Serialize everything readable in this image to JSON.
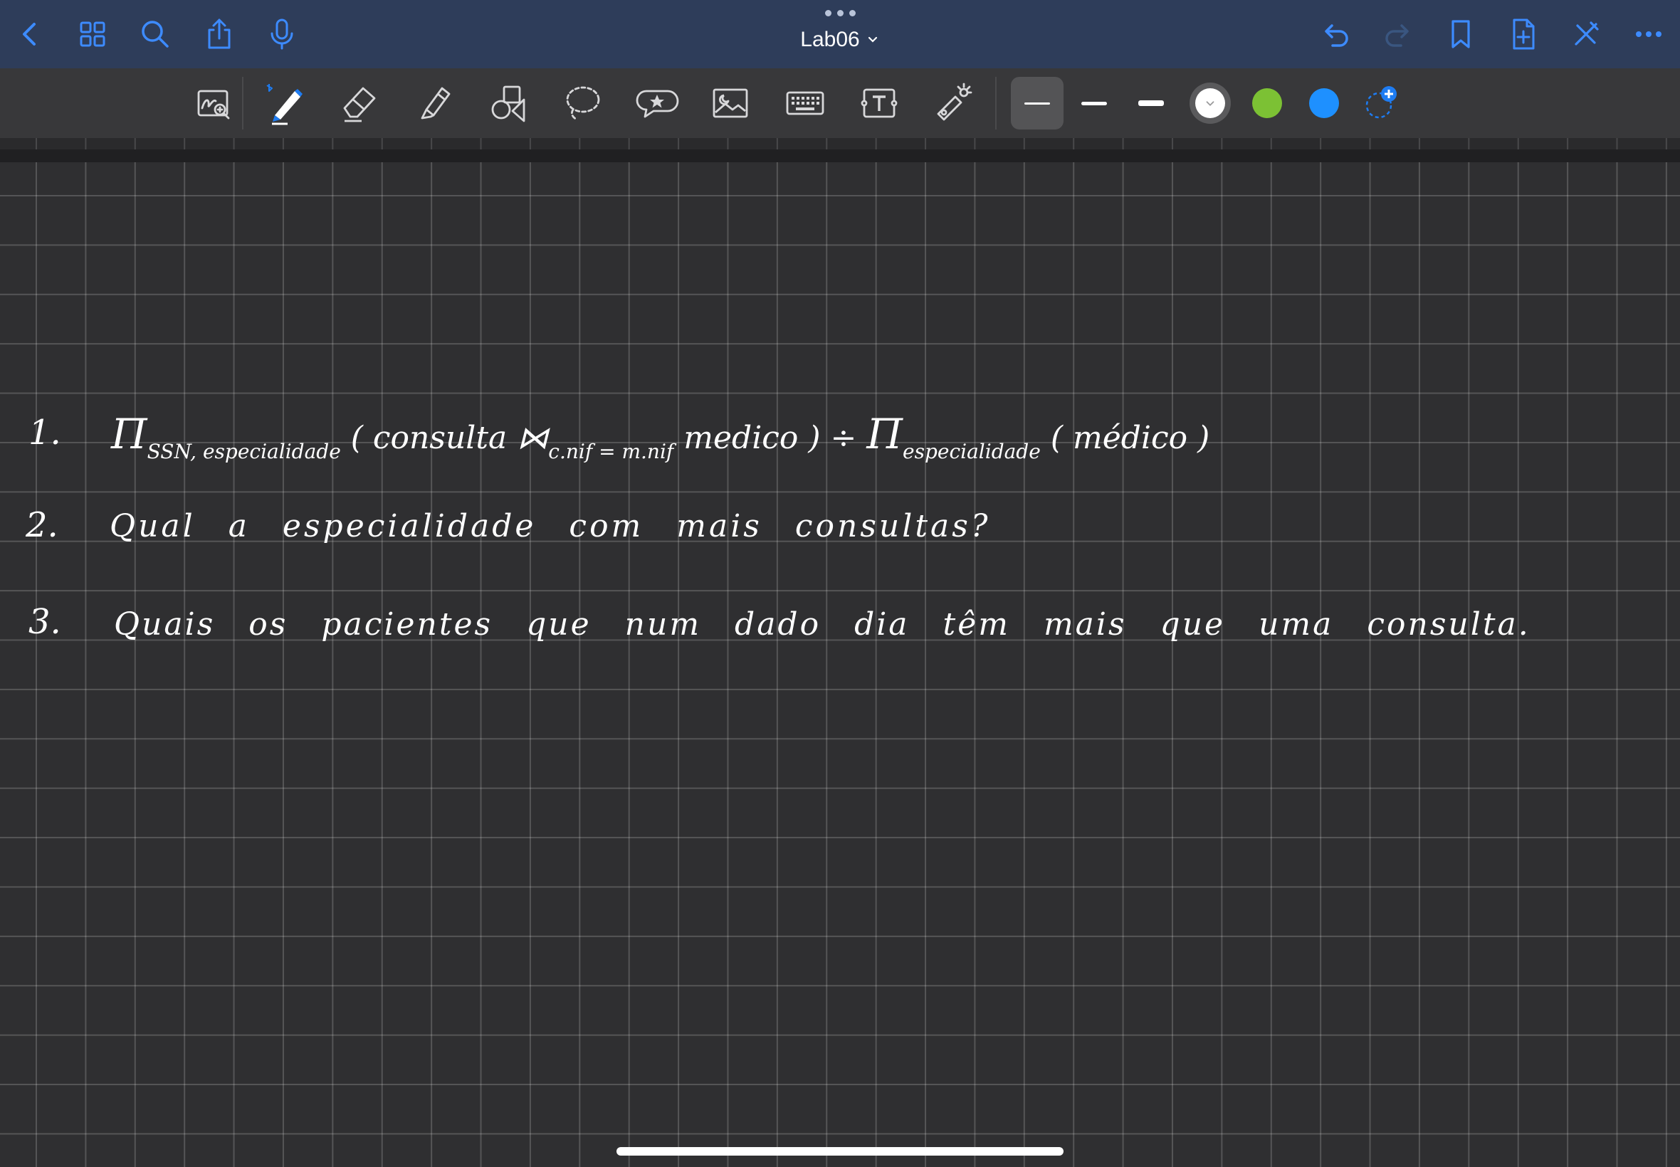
{
  "window": {
    "title": "Lab06"
  },
  "nav": {
    "left_icons": [
      "back-icon",
      "thumbnails-grid-icon",
      "search-icon",
      "share-icon",
      "microphone-icon"
    ],
    "right_icons": [
      "undo-icon",
      "redo-icon",
      "bookmark-icon",
      "add-page-icon",
      "close-pencil-icon",
      "more-icon"
    ]
  },
  "toolbar": {
    "tools": [
      "zoom-window-icon",
      "pen-icon",
      "eraser-icon",
      "highlighter-icon",
      "shapes-icon",
      "lasso-icon",
      "elements-icon",
      "image-icon",
      "keyboard-icon",
      "text-box-icon",
      "laser-pointer-icon"
    ],
    "selected_tool": "pen-icon",
    "stroke_widths": [
      "thin",
      "medium",
      "thick"
    ],
    "selected_stroke": "thin",
    "colors": [
      "#ffffff",
      "#7cc134",
      "#1e90ff"
    ],
    "selected_color": "#ffffff",
    "accent": "#1e7cf2"
  },
  "notes": {
    "line1": {
      "number": "1.",
      "pi1": "Π",
      "pi1_sub": "SSN, especialidade",
      "open1": "( consulta ⋈",
      "join_sub": "c.nif = m.nif",
      "rel": "medico ) ÷",
      "pi2": "Π",
      "pi2_sub": "especialidade",
      "tail": "( médico )"
    },
    "line2": {
      "number": "2.",
      "text": "Qual a especialidade com mais consultas?"
    },
    "line3": {
      "number": "3.",
      "text": "Quais os pacientes que num dado dia têm mais que uma consulta."
    }
  }
}
